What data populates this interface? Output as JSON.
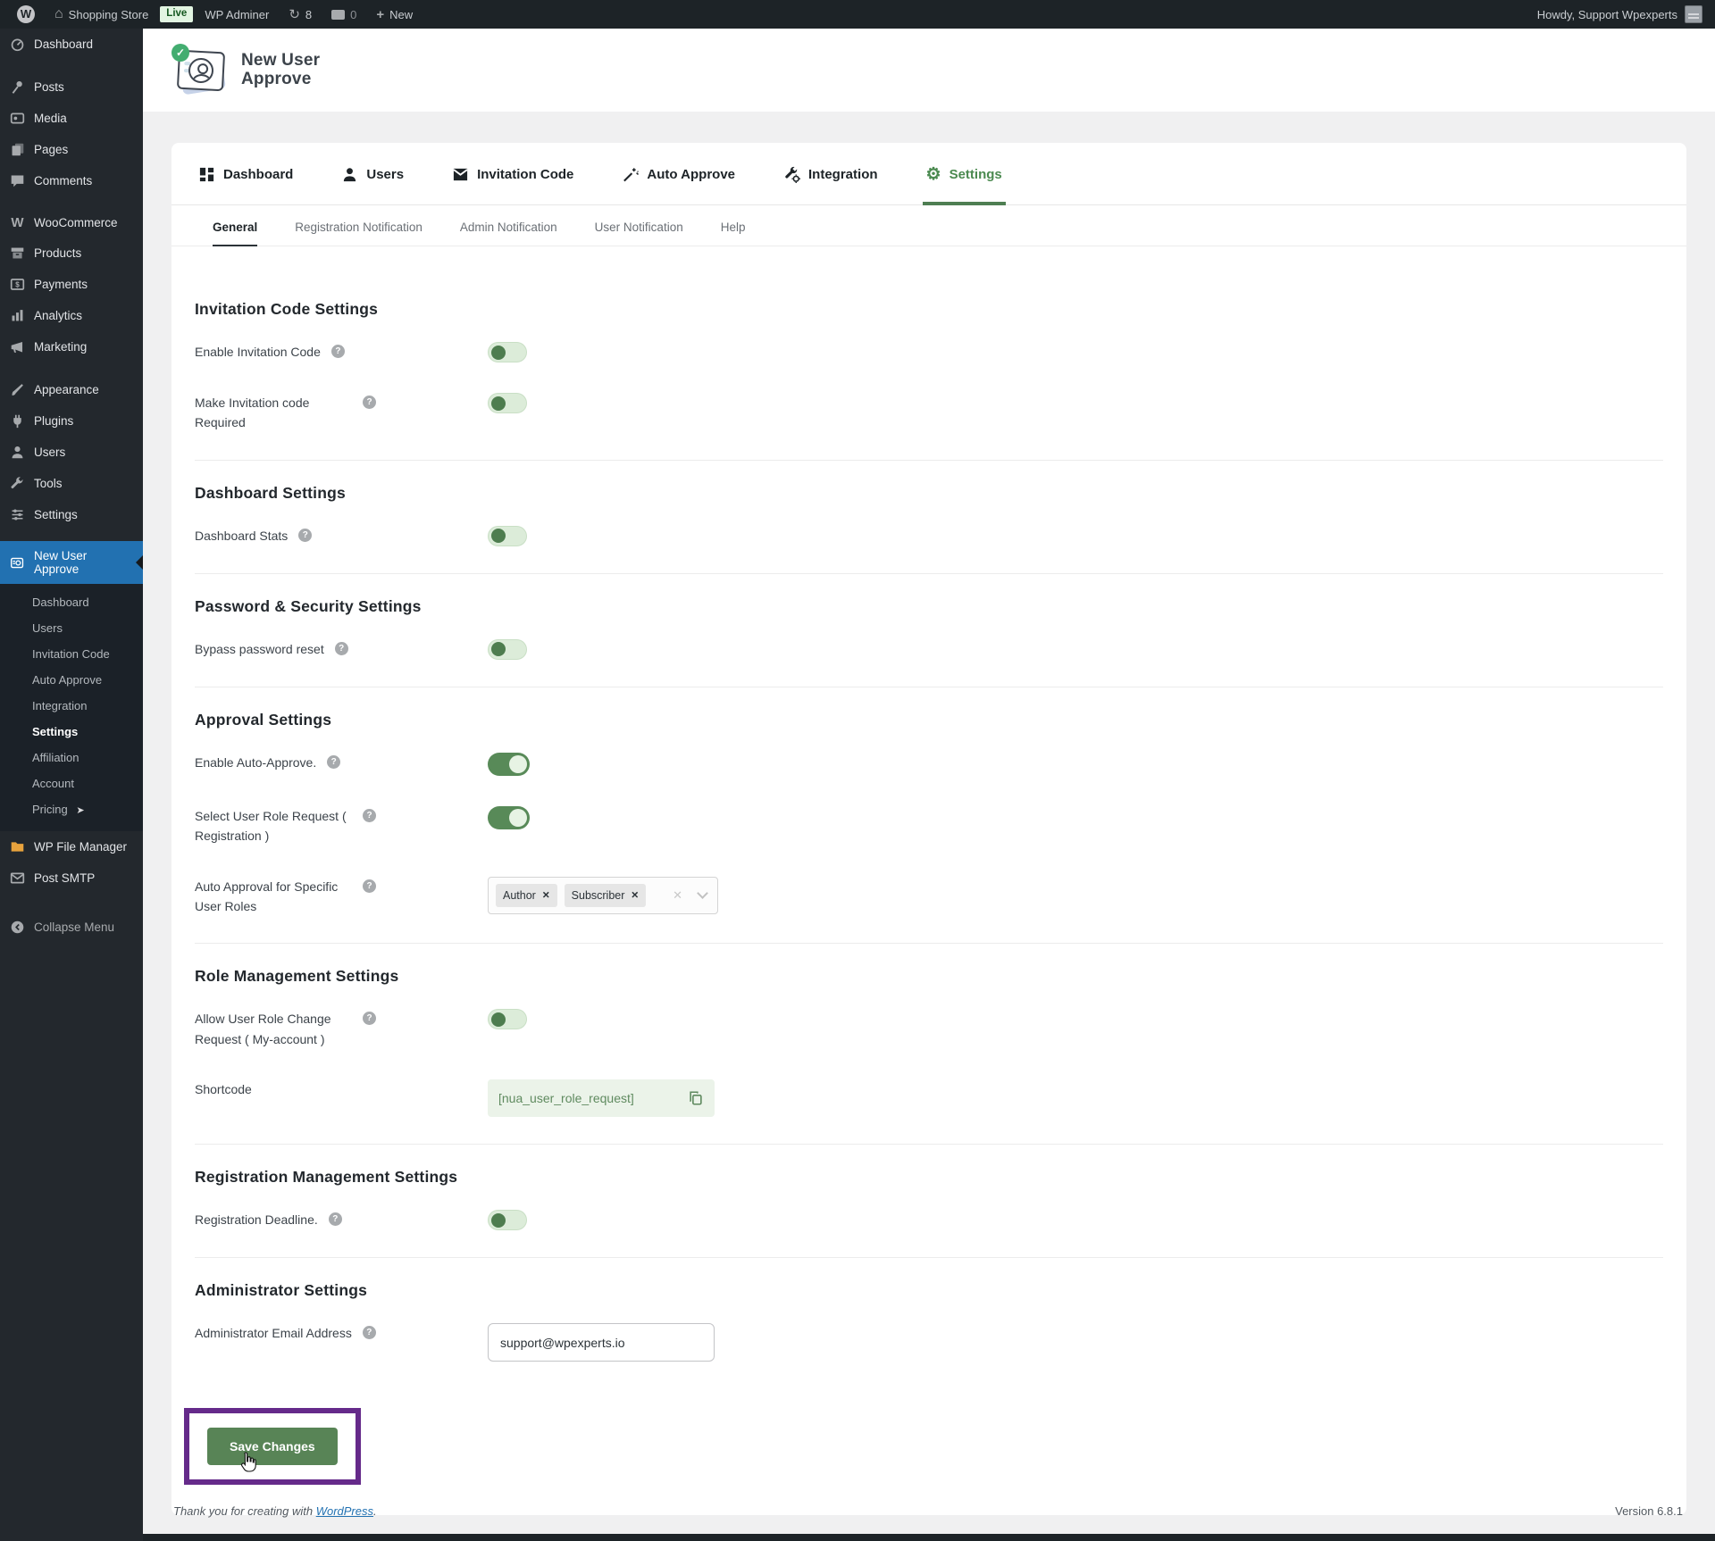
{
  "admin_bar": {
    "wp_logo": "W",
    "site_name": "Shopping Store",
    "live_badge": "Live",
    "adminer_label": "WP Adminer",
    "updates_count": "8",
    "comments_count": "0",
    "new_label": "New",
    "howdy": "Howdy, Support Wpexperts"
  },
  "sidebar": {
    "menu": [
      {
        "label": "Dashboard"
      },
      {
        "label": "Posts"
      },
      {
        "label": "Media"
      },
      {
        "label": "Pages"
      },
      {
        "label": "Comments"
      },
      {
        "label": "WooCommerce"
      },
      {
        "label": "Products"
      },
      {
        "label": "Payments"
      },
      {
        "label": "Analytics"
      },
      {
        "label": "Marketing"
      },
      {
        "label": "Appearance"
      },
      {
        "label": "Plugins"
      },
      {
        "label": "Users"
      },
      {
        "label": "Tools"
      },
      {
        "label": "Settings"
      }
    ],
    "nua": {
      "label": "New User Approve",
      "submenu": [
        "Dashboard",
        "Users",
        "Invitation Code",
        "Auto Approve",
        "Integration",
        "Settings",
        "Affiliation",
        "Account",
        "Pricing"
      ],
      "current_submenu": "Settings",
      "pricing_arrow": "➤"
    },
    "bottom": {
      "file_manager": "WP File Manager",
      "post_smtp": "Post SMTP",
      "collapse": "Collapse Menu"
    }
  },
  "plugin_header": {
    "title_line1": "New User",
    "title_line2": "Approve"
  },
  "tabs": [
    {
      "label": "Dashboard",
      "active": false
    },
    {
      "label": "Users",
      "active": false
    },
    {
      "label": "Invitation Code",
      "active": false
    },
    {
      "label": "Auto Approve",
      "active": false
    },
    {
      "label": "Integration",
      "active": false
    },
    {
      "label": "Settings",
      "active": true
    }
  ],
  "subtabs": [
    {
      "label": "General",
      "active": true
    },
    {
      "label": "Registration Notification",
      "active": false
    },
    {
      "label": "Admin Notification",
      "active": false
    },
    {
      "label": "User Notification",
      "active": false
    },
    {
      "label": "Help",
      "active": false
    }
  ],
  "settings": {
    "invitation": {
      "title": "Invitation Code Settings",
      "enable_label": "Enable Invitation Code",
      "enable_on": false,
      "required_label": "Make Invitation code Required",
      "required_on": false
    },
    "dashboard": {
      "title": "Dashboard Settings",
      "stats_label": "Dashboard Stats",
      "stats_on": false
    },
    "security": {
      "title": "Password & Security Settings",
      "bypass_label": "Bypass password reset",
      "bypass_on": false
    },
    "approval": {
      "title": "Approval Settings",
      "auto_approve_label": "Enable Auto-Approve.",
      "auto_approve_on": true,
      "role_request_label": "Select User Role Request ( Registration )",
      "role_request_on": true,
      "specific_roles_label": "Auto Approval for Specific User Roles",
      "selected_roles": [
        "Author",
        "Subscriber"
      ],
      "chip_remove_glyph": "✕",
      "clear_glyph": "✕"
    },
    "role_management": {
      "title": "Role Management Settings",
      "allow_change_label": "Allow User Role Change Request ( My-account )",
      "allow_change_on": false,
      "shortcode_label": "Shortcode",
      "shortcode_value": "[nua_user_role_request]"
    },
    "registration": {
      "title": "Registration Management Settings",
      "deadline_label": "Registration Deadline.",
      "deadline_on": false
    },
    "administrator": {
      "title": "Administrator Settings",
      "email_label": "Administrator Email Address",
      "email_value": "support@wpexperts.io",
      "save_label": "Save Changes"
    }
  },
  "footer": {
    "thanks_prefix": "Thank you for creating with ",
    "wordpress_link": "WordPress",
    "thanks_suffix": ".",
    "version": "Version 6.8.1"
  },
  "colors": {
    "accent_green": "#588456",
    "toggle_off_track": "#dcecd9",
    "toggle_off_knob": "#4e7d4f",
    "active_menu_blue": "#2271b1",
    "annotation_purple": "#652a8a",
    "live_badge_green": "#e2f5e2"
  }
}
